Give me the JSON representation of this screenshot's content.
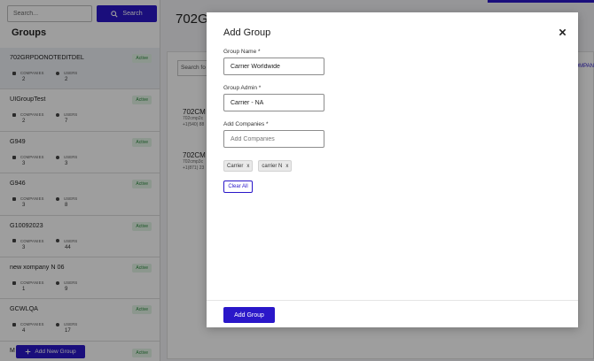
{
  "sidebar": {
    "search_placeholder": "Search...",
    "search_button": "Search",
    "title": "Groups",
    "stat_labels": {
      "companies": "COMPANIES",
      "users": "USERS"
    },
    "groups": [
      {
        "name": "702GRPDONOTEDITDEL",
        "status": "Active",
        "companies": "2",
        "users": "2"
      },
      {
        "name": "UIGroupTest",
        "status": "Active",
        "companies": "2",
        "users": "7"
      },
      {
        "name": "G949",
        "status": "Active",
        "companies": "3",
        "users": "3"
      },
      {
        "name": "G946",
        "status": "Active",
        "companies": "3",
        "users": "8"
      },
      {
        "name": "G10092023",
        "status": "Active",
        "companies": "3",
        "users": "44"
      },
      {
        "name": "new xompany N 06",
        "status": "Active",
        "companies": "1",
        "users": "9"
      },
      {
        "name": "GCWLQA",
        "status": "Active",
        "companies": "4",
        "users": "17"
      }
    ],
    "peek": {
      "initial": "M",
      "status": "Active"
    },
    "add_new_group": "Add New Group"
  },
  "main": {
    "title": "702G",
    "search_placeholder": "Search fo",
    "right_link": "OMPAN",
    "companies": [
      {
        "name": "702CM",
        "line1": "702cmp2c",
        "line2": "+1(540) 88"
      },
      {
        "name": "702CM",
        "line1": "702cmp3c",
        "line2": "+1(871) 23"
      }
    ]
  },
  "modal": {
    "title": "Add Group",
    "fields": {
      "group_name": {
        "label": "Group Name *",
        "value": "Carrier Worldwide"
      },
      "group_admin": {
        "label": "Group Admin *",
        "value": "Carrier - NA"
      },
      "add_companies": {
        "label": "Add Companies *",
        "placeholder": "Add Companies"
      }
    },
    "chips": [
      "Carrier",
      "carrier N"
    ],
    "chip_remove": "x",
    "clear_all": "Clear All",
    "submit": "Add Group"
  },
  "colors": {
    "accent": "#2a17c9",
    "active_badge": "#2b8a3e"
  }
}
